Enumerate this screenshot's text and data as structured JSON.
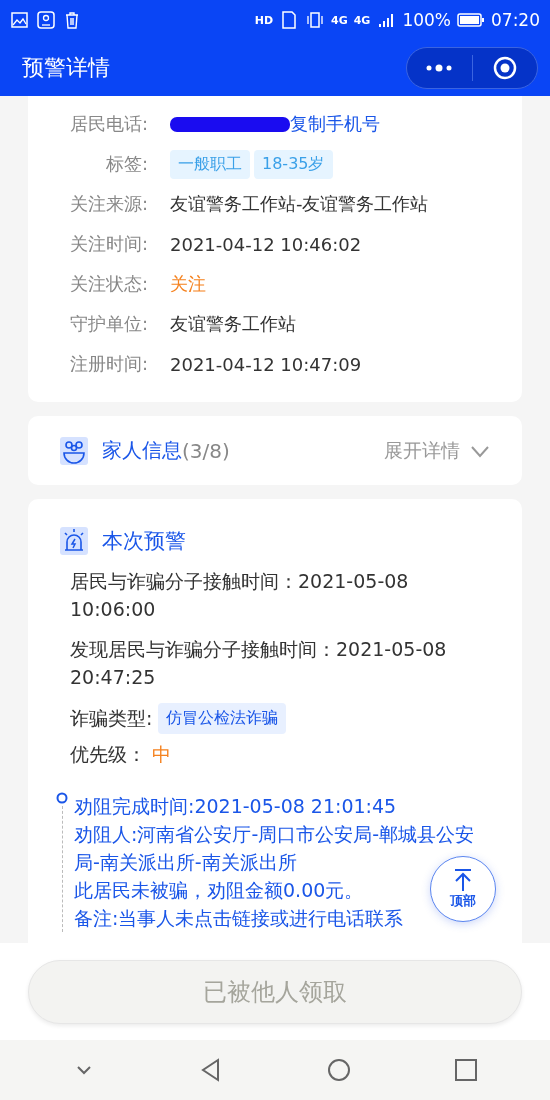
{
  "status_bar": {
    "network_labels": [
      "HD",
      "4G",
      "4G"
    ],
    "battery": "100%",
    "time": "07:20"
  },
  "nav_bar": {
    "title": "预警详情"
  },
  "resident_card": {
    "phone": {
      "label": "居民电话:",
      "redacted": true,
      "copy_link": "复制手机号"
    },
    "tags": {
      "label": "标签:",
      "items": [
        "一般职工",
        "18-35岁"
      ]
    },
    "fields": [
      {
        "label": "关注来源:",
        "value": "友谊警务工作站-友谊警务工作站",
        "kind": "normal"
      },
      {
        "label": "关注时间:",
        "value": "2021-04-12 10:46:02",
        "kind": "normal"
      },
      {
        "label": "关注状态:",
        "value": "关注",
        "kind": "highlight"
      },
      {
        "label": "守护单位:",
        "value": "友谊警务工作站",
        "kind": "normal"
      },
      {
        "label": "注册时间:",
        "value": "2021-04-12 10:47:09",
        "kind": "normal"
      }
    ]
  },
  "family_card": {
    "title": "家人信息",
    "count": "(3/8)",
    "expand": "展开详情",
    "expanded": false
  },
  "alert_card": {
    "title": "本次预警",
    "rows": [
      {
        "kind": "text",
        "text": "居民与诈骗分子接触时间：2021-05-08 10:06:00"
      },
      {
        "kind": "text",
        "text": "发现居民与诈骗分子接触时间：2021-05-08 20:47:25"
      },
      {
        "kind": "tag",
        "label": "诈骗类型:",
        "value": "仿冒公检法诈骗"
      },
      {
        "kind": "priority",
        "label": "优先级：",
        "value": "中"
      }
    ],
    "timeline": [
      {
        "lines": [
          "劝阻完成时间:2021-05-08 21:01:45",
          "劝阻人:河南省公安厅-周口市公安局-郸城县公安局-南关派出所-南关派出所",
          "此居民未被骗，劝阻金额0.00元。",
          "备注:当事人未点击链接或进行电话联系"
        ]
      }
    ]
  },
  "top_button": {
    "label": "顶部"
  },
  "claim_button": {
    "label": "已被他人领取",
    "disabled": true
  }
}
